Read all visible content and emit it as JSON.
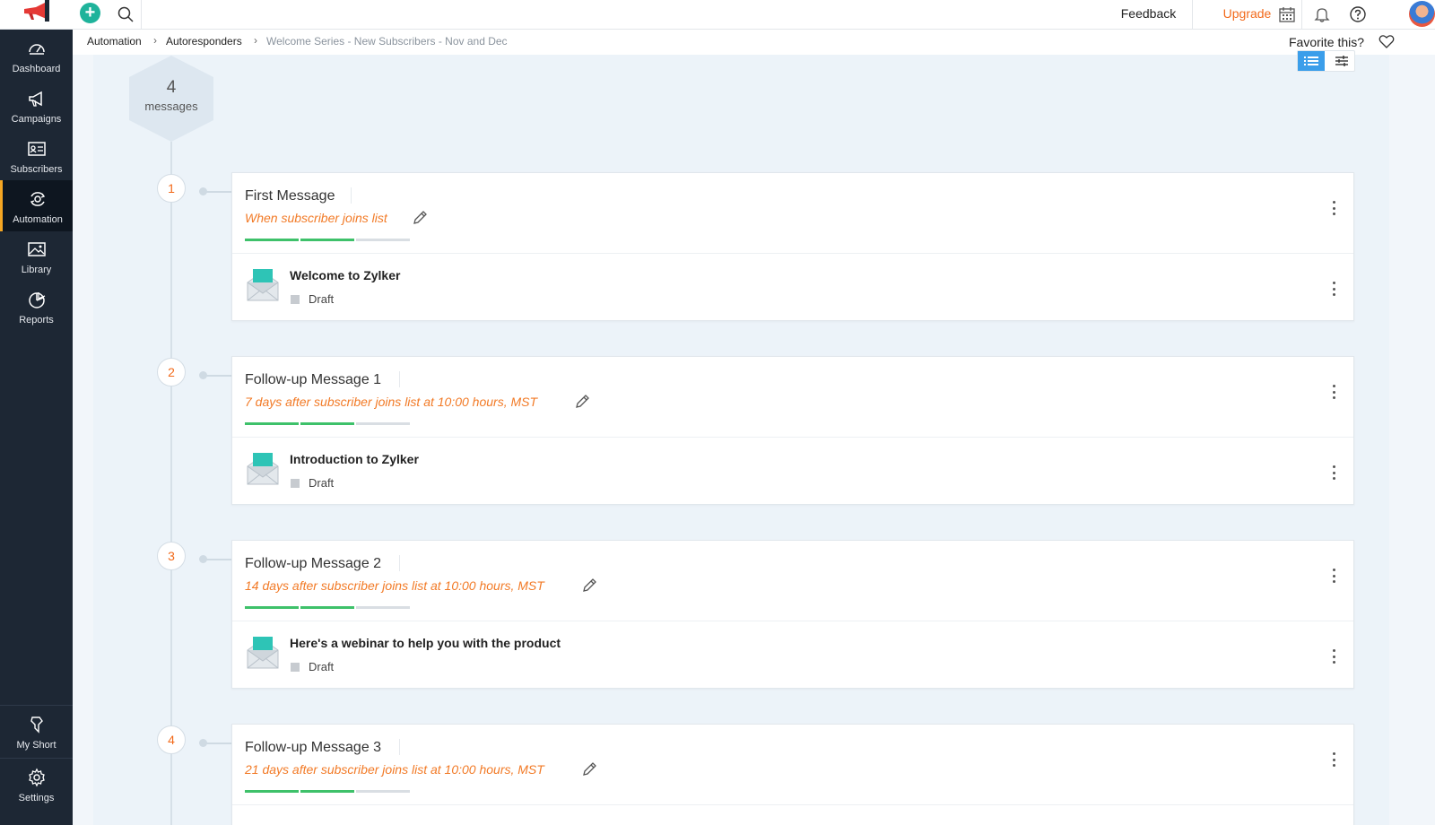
{
  "topbar": {
    "feedback_label": "Feedback",
    "upgrade_label": "Upgrade",
    "upgrade_color": "#f26a1b",
    "icons": [
      "megaphone-logo",
      "plus-icon",
      "search-icon",
      "calendar-icon",
      "bell-icon",
      "help-icon",
      "avatar"
    ]
  },
  "sidebar": {
    "items": [
      {
        "label": "Dashboard",
        "icon": "gauge-icon"
      },
      {
        "label": "Campaigns",
        "icon": "megaphone-icon"
      },
      {
        "label": "Subscribers",
        "icon": "id-card-icon"
      },
      {
        "label": "Automation",
        "icon": "automation-icon",
        "active": true
      },
      {
        "label": "Library",
        "icon": "image-icon"
      },
      {
        "label": "Reports",
        "icon": "pie-chart-icon"
      }
    ],
    "bottom_items": [
      {
        "label": "My Short",
        "icon": "shortcut-icon"
      },
      {
        "label": "Settings",
        "icon": "gear-icon"
      }
    ]
  },
  "breadcrumb": {
    "items": [
      "Automation",
      "Autoresponders",
      "Welcome Series - New Subscribers - Nov and Dec"
    ],
    "separator": "›"
  },
  "favorite_label": "Favorite this?",
  "summary": {
    "count": "4",
    "label": "messages"
  },
  "messages": [
    {
      "step": "1",
      "title": "First Message",
      "trigger": "When subscriber joins list",
      "progress": [
        true,
        true,
        false
      ],
      "email_name": "Welcome to Zylker",
      "status": "Draft"
    },
    {
      "step": "2",
      "title": "Follow-up Message 1",
      "trigger": "7  days after subscriber joins list at  10:00 hours, MST",
      "progress": [
        true,
        true,
        false
      ],
      "email_name": "Introduction to Zylker",
      "status": "Draft"
    },
    {
      "step": "3",
      "title": "Follow-up Message 2",
      "trigger": "14  days after subscriber joins list at  10:00 hours, MST",
      "progress": [
        true,
        true,
        false
      ],
      "email_name": "Here's a webinar to help you with the product",
      "status": "Draft"
    },
    {
      "step": "4",
      "title": "Follow-up Message 3",
      "trigger": "21  days after subscriber joins list at  10:00 hours, MST",
      "progress": [
        true,
        true,
        false
      ],
      "email_name": "",
      "status": ""
    }
  ],
  "colors": {
    "accent_orange": "#f27a26",
    "progress_done": "#3ec16a",
    "progress_todo": "#d9dee3",
    "sidebar_bg": "#1d2734",
    "toggle_active": "#3b9eea"
  }
}
